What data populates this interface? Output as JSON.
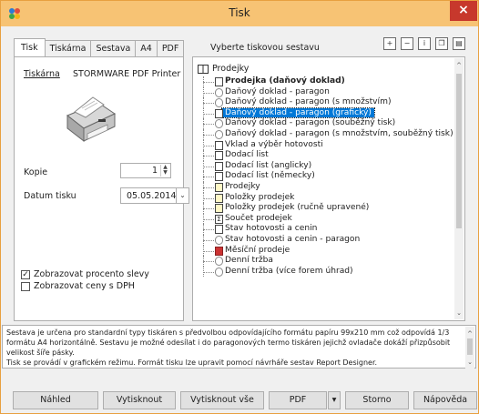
{
  "window": {
    "title": "Tisk"
  },
  "tabs": [
    "Tisk",
    "Tiskárna",
    "Sestava",
    "A4",
    "PDF"
  ],
  "section_label": "Vyberte tiskovou sestavu",
  "toolbar_icons": [
    "expand-all-icon",
    "collapse-all-icon",
    "info-icon",
    "copy-icon",
    "paste-icon"
  ],
  "printer": {
    "link_label": "Tiskárna",
    "name": "STORMWARE PDF Printer"
  },
  "copies": {
    "label": "Kopie",
    "value": "1"
  },
  "print_date": {
    "label": "Datum tisku",
    "value": "05.05.2014"
  },
  "checkboxes": [
    {
      "label": "Zobrazovat procento slevy",
      "checked": true
    },
    {
      "label": "Zobrazovat ceny s DPH",
      "checked": false
    }
  ],
  "tree": {
    "root": "Prodejky",
    "items": [
      {
        "label": "Prodejka (daňový doklad)",
        "icon": "doc",
        "bold": true
      },
      {
        "label": "Daňový doklad - paragon",
        "icon": "round"
      },
      {
        "label": "Daňový doklad - paragon (s množstvím)",
        "icon": "round"
      },
      {
        "label": "Daňový doklad - paragon (grafický)",
        "icon": "doc",
        "selected": true
      },
      {
        "label": "Daňový doklad - paragon (souběžný tisk)",
        "icon": "round"
      },
      {
        "label": "Daňový doklad - paragon (s množstvím, souběžný tisk)",
        "icon": "round"
      },
      {
        "label": "Vklad a výběr hotovosti",
        "icon": "doc"
      },
      {
        "label": "Dodací list",
        "icon": "doc"
      },
      {
        "label": "Dodací list (anglicky)",
        "icon": "doc"
      },
      {
        "label": "Dodací list (německy)",
        "icon": "doc"
      },
      {
        "label": "Prodejky",
        "icon": "sheet"
      },
      {
        "label": "Položky prodejek",
        "icon": "sheet"
      },
      {
        "label": "Položky prodejek (ručně upravené)",
        "icon": "sheet"
      },
      {
        "label": "Součet prodejek",
        "icon": "sum"
      },
      {
        "label": "Stav hotovosti a cenin",
        "icon": "doc"
      },
      {
        "label": "Stav hotovosti a cenin - paragon",
        "icon": "round"
      },
      {
        "label": "Měsíční prodeje",
        "icon": "red"
      },
      {
        "label": "Denní tržba",
        "icon": "round"
      },
      {
        "label": "Denní tržba (více forem úhrad)",
        "icon": "round"
      }
    ]
  },
  "description": [
    "Sestava je určena pro standardní typy tiskáren s předvolbou odpovídajícího formátu papíru 99x210 mm což odpovídá 1/3 formátu A4 horizontálně. Sestavu je možné odesílat i do paragonových termo tiskáren jejichž ovladače dokáží přizpůsobit velikost šíře pásky.",
    "Tisk se provádí v grafickém režimu. Formát tisku lze upravit pomocí návrháře sestav Report Designer."
  ],
  "buttons": {
    "preview": "Náhled",
    "print": "Vytisknout",
    "print_all": "Vytisknout vše",
    "pdf": "PDF",
    "pdf_menu": "▾",
    "cancel": "Storno",
    "help": "Nápověda"
  }
}
